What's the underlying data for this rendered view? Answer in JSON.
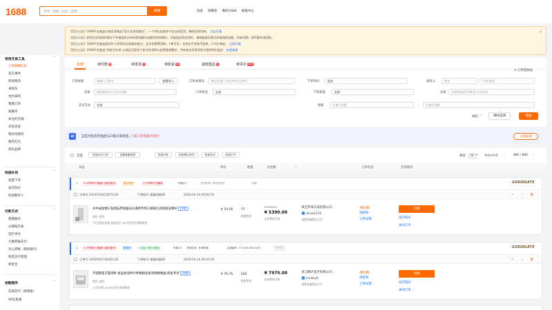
{
  "header": {
    "logo": "1688",
    "search_placeholder": "文件 / 图搜 / 拉拉 / 配到",
    "search_button": "搜索",
    "nav": [
      "消息",
      "购物车",
      "我的1688",
      "商家中心"
    ]
  },
  "notices": [
    {
      "text": "【官方公告】1688平台推出分销买家推出\"官方仓退货服务\"，一个地址处理多平台自动验货，确保全网包邮。",
      "link": "点击开通"
    },
    {
      "text": "【官方公告】如您在未找到的情况下申请退款分析时原则解决金额付款的模式，可能造成资金损失，请根据真实情况申请退款金额，如有问题，请不要申请退款。",
      "link": ""
    },
    {
      "text": "【官方公告】1688平台推出面向中小采家的全面服务能力，无任发售费用和，1单可发，支持全平台电子面单，1.6元/单起。",
      "link": "立即开通"
    },
    {
      "text": "【官方公告】1688平台推出\"多账号往来\"以满足买家多个账号的采购与经营管理需求，并有机会享受多账号提供6折权益！",
      "link": "欢迎查看"
    }
  ],
  "sidebar": {
    "sections": [
      {
        "title": "常用交易工具",
        "items": [
          "订单明细信息",
          "官方事件",
          "跨境物流",
          "采购车",
          "合约采购",
          "我期订单",
          "收藏夹",
          "关注的店铺",
          "浏览足迹",
          "我的优惠券",
          "我的红包",
          "索码品牌"
        ]
      },
      {
        "title": "快速补货",
        "items": [
          "批量下单",
          "再次购买",
          "找加数字人"
        ]
      },
      {
        "title": "付款方式",
        "items": [
          "我期服务",
          "分期按交易",
          "电子承兑",
          "大额转账支付",
          "对公转账（网商银行）",
          "免密支付管理",
          "跨境宝"
        ]
      },
      {
        "title": "金融服务",
        "items": [
          "先采后付（赊销金）",
          "88生意通"
        ]
      }
    ]
  },
  "tabs": [
    {
      "label": "全部",
      "badge": ""
    },
    {
      "label": "待付款",
      "badge": "9"
    },
    {
      "label": "待发货",
      "badge": "1"
    },
    {
      "label": "待收货",
      "badge": "4K"
    },
    {
      "label": "退款售后",
      "badge": "1"
    },
    {
      "label": "待评价",
      "badge": "187"
    }
  ],
  "recycle_bin": "订单回收站",
  "filters": {
    "order_search_label": "订单搜索",
    "order_search_ph": "请输入订单号",
    "bulk_import": "批量导入",
    "keyword_label": "订单关键词",
    "keyword_ph": "商品名称/下游订单号/运单号",
    "order_time_label": "下单时间",
    "order_time_value": "全部",
    "recipient_label": "收货人",
    "recipient_ph": "姓名",
    "phone_ph": "手机/电话",
    "seller_label": "卖家",
    "seller_ph": "卖家登录名/公司/店铺名",
    "status_label": "订单状态",
    "status_value": "全部",
    "channel_label": "下单渠道",
    "channel_value": "全部",
    "buyer_label": "买家",
    "buyer_ph": "买家登录名/子账号/公司主体",
    "pay_label": "支付方式",
    "pay_value": "全部",
    "amount_label": "金额",
    "min_ph": "¥ 最小金额",
    "max_ph": "¥ 最大金额",
    "collapse": "收起",
    "reset": "清除选项",
    "search": "搜索"
  },
  "ai_bar": {
    "icon": "AI",
    "text": "正在为您实时监控123笔订单状态，",
    "highlight": "5笔订单有履约风险",
    "link": "立即处理"
  },
  "toolbar": {
    "select_all": "全选",
    "buttons": [
      "批量标记订单",
      "全部批量发货",
      "批量付款",
      "批量确认收货",
      "批量导出",
      "批量打印"
    ],
    "pager": "每页",
    "page_size": "10",
    "total": "共8649条",
    "page": "880 / 885"
  },
  "table_headers": [
    "货品",
    "单价",
    "数量",
    "总金额",
    "订单状态",
    "交易操作"
  ],
  "orders": [
    {
      "tags": [
        "⚠ 오역되지 마을동 (결제 불가)",
        "部分发货",
        "⚠ 오역되지 마을동",
        "专属4小",
        "发货时间: 按约定发货",
        "运单"
      ],
      "brand": "GOODGATE",
      "order_no_label": "订单号",
      "order_no": "2419743422875136",
      "order_type": "下单账号 瑛瑛网络88",
      "time": "2026-04-24 09:00:19",
      "product_title": "水中皮肤模三角测压传感器光仪通用专用三脚吸孔双铆接支撑杆",
      "product_tag": "[详情]",
      "product_spec": "颜色: 颜色",
      "product_meta": "7天无理由包换    极速发货    48小时发货    跨境物流",
      "unit_price": "¥ 70.00",
      "qty": "77",
      "qty_note": "查看物流",
      "original_amount": "¥7980.00",
      "amount": "¥ 5390.00",
      "amount_note": "支持提前付款",
      "seller": "商丘市海工具有限公司",
      "seller_ww": "zhao1233",
      "seller_note": "查看流量图出方式",
      "status": "待付款",
      "status_links": [
        "找新商",
        "订单详情"
      ],
      "pay_button": "付款",
      "action_links": [
        "再次购买",
        "关闭订单"
      ]
    },
    {
      "tags": [
        "⚠ 오역되지 마을동 (결제 불가)",
        "跟单员",
        "✔ 检仕 세부 등록동",
        "专属4小",
        "物流状态: 申请快递",
        "运送编号: 77318945622185",
        "UBAS"
      ],
      "brand": "GOODGATE",
      "order_no_label": "订单号",
      "order_no": "2418464378185136",
      "order_type": "下单账号 瑛瑛网络88",
      "time": "2026-04-24 08:47:00",
      "product_title": "不锈钢电子圆顶秤 食品体温秤计秤精厨房家用称精致器 商家专享",
      "product_tag": "[详情]",
      "product_spec": "颜色: 颜色",
      "product_meta": "15天包换    48小时发货    跨境物流",
      "unit_price": "¥ 79.75",
      "qty": "100",
      "qty_note": "查看物流",
      "original_amount": "",
      "amount": "¥ 7975.00",
      "amount_note": "支持提前付款",
      "seller": "浙江精达电子有限公司",
      "seller_ww": "hvidayh",
      "seller_note": "查看流量图出方式",
      "status": "待付款",
      "status_links": [
        "找新商",
        "订单详情"
      ],
      "pay_button": "付款",
      "action_links": [
        "再次购买",
        "关闭订单"
      ]
    }
  ],
  "colors": {
    "accent": "#ff6a00",
    "link": "#1e6fff",
    "danger": "#ff4d4f"
  }
}
